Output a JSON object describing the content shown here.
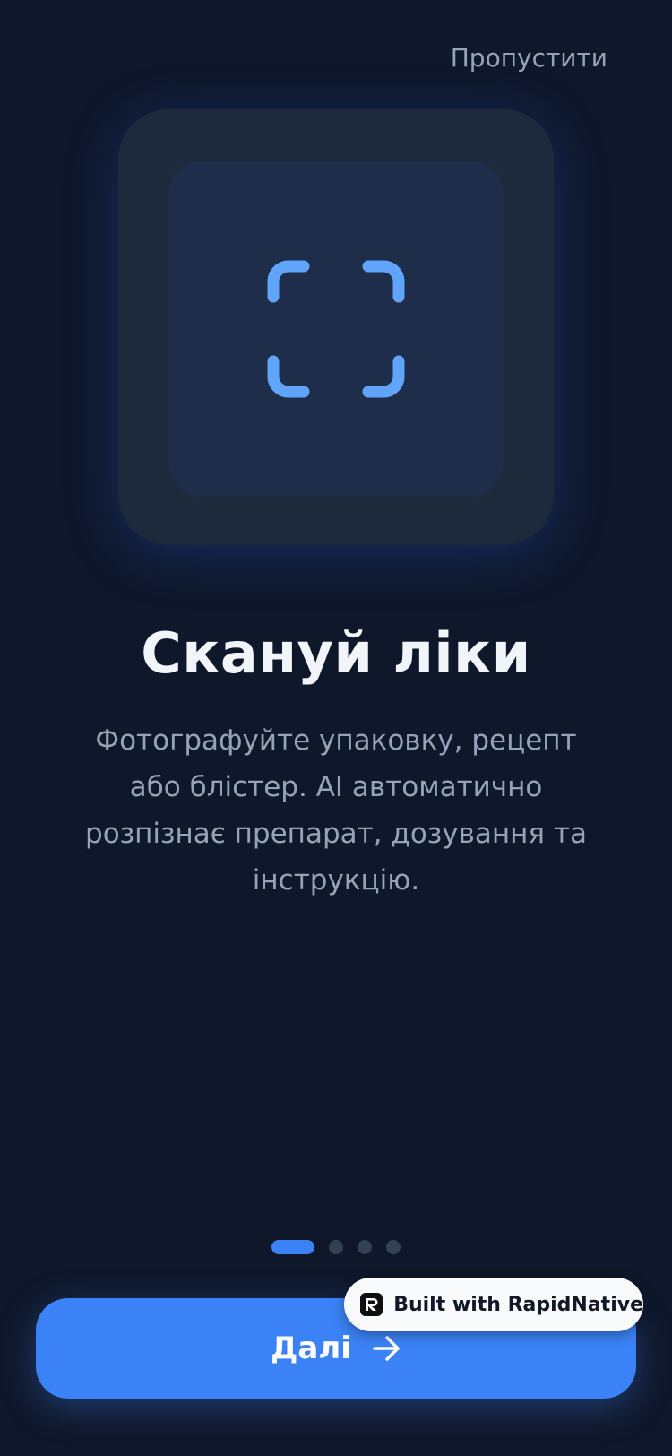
{
  "header": {
    "skip_label": "Пропустити"
  },
  "hero": {
    "icon": "scan-frame-icon"
  },
  "content": {
    "title": "Скануй ліки",
    "description": "Фотографуйте упаковку, рецепт або блістер. AI автоматично розпізнає препарат, дозування та інструкцію."
  },
  "pagination": {
    "total": 4,
    "current": 1
  },
  "footer": {
    "next_label": "Далі",
    "next_icon": "arrow-right-icon"
  },
  "badge": {
    "label": "Built with RapidNative",
    "icon": "rapidnative-logo-icon"
  },
  "colors": {
    "background": "#0f172a",
    "card_outer": "#1e293b",
    "card_inner": "#1e2d4a",
    "accent": "#3b82f6",
    "icon_accent": "#60a5fa",
    "muted_text": "#94a3b8",
    "title_text": "#f1f5f9",
    "inactive_dot": "#334155"
  }
}
